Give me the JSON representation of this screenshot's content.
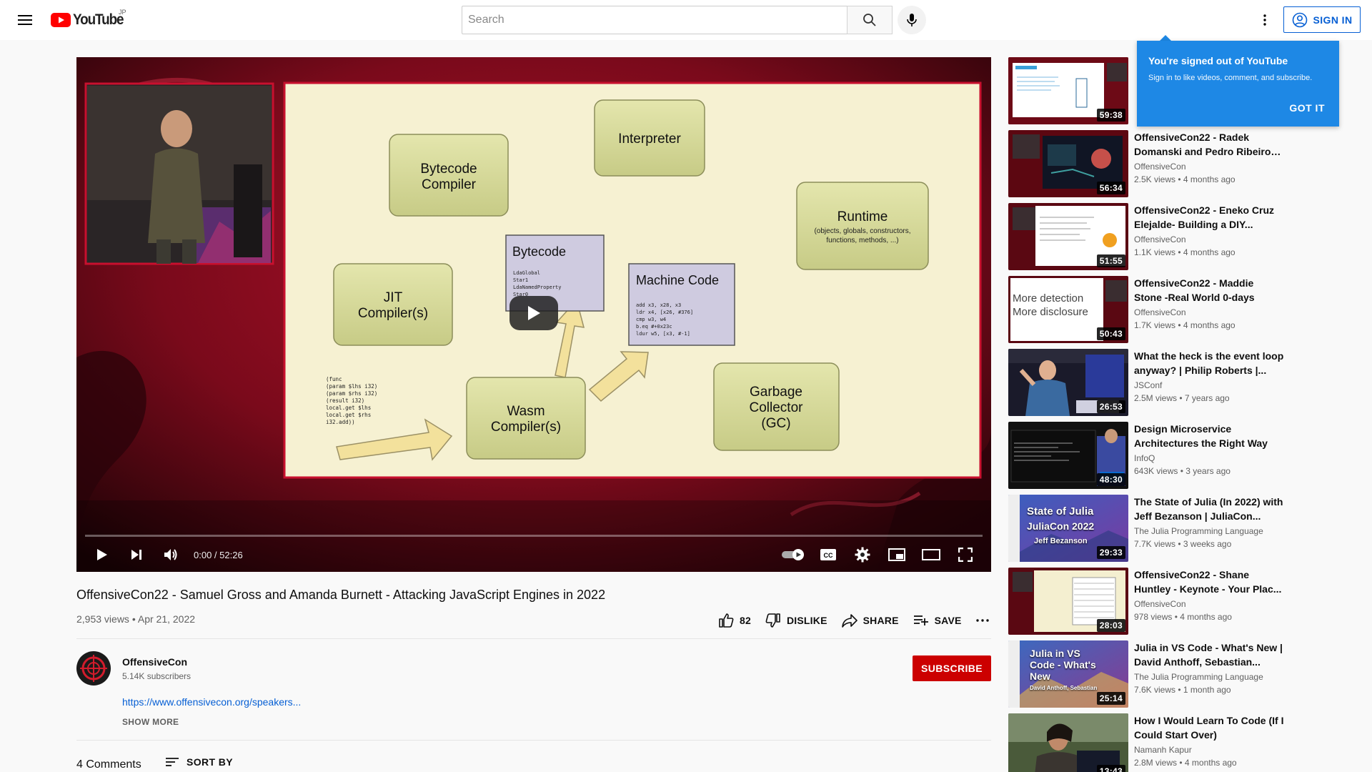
{
  "masthead": {
    "logo_text": "YouTube",
    "country_code": "JP",
    "search_placeholder": "Search",
    "signin_label": "SIGN IN"
  },
  "player": {
    "time": "0:00 / 52:26",
    "progress": 0.0,
    "slide": {
      "boxes": {
        "bytecode_compiler": [
          "Bytecode",
          "Compiler"
        ],
        "interpreter": "Interpreter",
        "runtime": "Runtime",
        "runtime_sub": "(objects, globals, constructors,",
        "runtime_sub2": "functions, methods, ...)",
        "jit": [
          "JIT",
          "Compiler(s)"
        ],
        "bytecode": "Bytecode",
        "bytecode_code": [
          "LdaGlobal",
          "Star1",
          "LdaNamedProperty",
          "Star0"
        ],
        "machine_code": "Machine Code",
        "machine_code_lines": [
          "add x3, x28, x3",
          "ldr x4, [x26, #376]",
          "cmp w3, w4",
          "b.eq #+0x23c",
          "ldur w5, [x3, #-1]"
        ],
        "wasm": [
          "Wasm",
          "Compiler(s)"
        ],
        "gc": [
          "Garbage",
          "Collector",
          "(GC)"
        ],
        "wasm_code": [
          "(func",
          " (param $lhs i32)",
          " (param $rhs i32)",
          " (result i32)",
          "  local.get $lhs",
          "  local.get $rhs",
          "  i32.add))"
        ]
      }
    }
  },
  "video": {
    "title": "OffensiveCon22 - Samuel Gross and Amanda Burnett - Attacking JavaScript Engines in 2022",
    "views": "2,953 views",
    "date": "Apr 21, 2022",
    "likes": "82",
    "dislike_label": "DISLIKE",
    "share_label": "SHARE",
    "save_label": "SAVE"
  },
  "channel": {
    "name": "OffensiveCon",
    "subscribers": "5.14K subscribers",
    "subscribe_label": "SUBSCRIBE",
    "description_link": "https://www.offensivecon.org/speakers...",
    "show_more": "SHOW MORE"
  },
  "comments": {
    "count": "4 Comments",
    "sort_label": "SORT BY"
  },
  "popup": {
    "title": "You're signed out of YouTube",
    "body": "Sign in to like videos, comment, and subscribe.",
    "button": "GOT IT"
  },
  "recommendations": [
    {
      "title": "",
      "channel": "",
      "meta": "",
      "duration": "59:38"
    },
    {
      "title": "OffensiveCon22 - Radek Domanski and Pedro Ribeiro -...",
      "channel": "OffensiveCon",
      "meta": "2.5K views • 4 months ago",
      "duration": "56:34"
    },
    {
      "title": "OffensiveCon22 - Eneko Cruz Elejalde- Building a DIY...",
      "channel": "OffensiveCon",
      "meta": "1.1K views • 4 months ago",
      "duration": "51:55"
    },
    {
      "title": "OffensiveCon22 - Maddie Stone -Real World 0-days",
      "channel": "OffensiveCon",
      "meta": "1.7K views • 4 months ago",
      "duration": "50:43",
      "thumb_text": [
        "More detection",
        "More disclosure"
      ]
    },
    {
      "title": "What the heck is the event loop anyway? | Philip Roberts |...",
      "channel": "JSConf",
      "meta": "2.5M views • 7 years ago",
      "duration": "26:53"
    },
    {
      "title": "Design Microservice Architectures the Right Way",
      "channel": "InfoQ",
      "meta": "643K views • 3 years ago",
      "duration": "48:30"
    },
    {
      "title": "The State of Julia (In 2022) with Jeff Bezanson | JuliaCon...",
      "channel": "The Julia Programming Language",
      "meta": "7.7K views • 3 weeks ago",
      "duration": "29:33",
      "thumb_text": [
        "State of Julia",
        "JuliaCon 2022",
        "Jeff Bezanson"
      ]
    },
    {
      "title": "OffensiveCon22 - Shane Huntley - Keynote - Your Plac...",
      "channel": "OffensiveCon",
      "meta": "978 views • 4 months ago",
      "duration": "28:03"
    },
    {
      "title": "Julia in VS Code - What's New | David Anthoff, Sebastian...",
      "channel": "The Julia Programming Language",
      "meta": "7.6K views • 1 month ago",
      "duration": "25:14",
      "thumb_text": [
        "Julia in VS",
        "Code - What's",
        "New",
        "David Anthoff, Sebastian"
      ]
    },
    {
      "title": "How I Would Learn To Code (If I Could Start Over)",
      "channel": "Namanh Kapur",
      "meta": "2.8M views • 4 months ago",
      "duration": "13:43"
    }
  ],
  "colors": {
    "brand_red": "#ff0000",
    "subscribe_red": "#cc0000",
    "link_blue": "#065fd4",
    "popup_blue": "#1e88e5",
    "slide_bg": "#f6f1d2",
    "box_fill": "#d9dc9e"
  }
}
